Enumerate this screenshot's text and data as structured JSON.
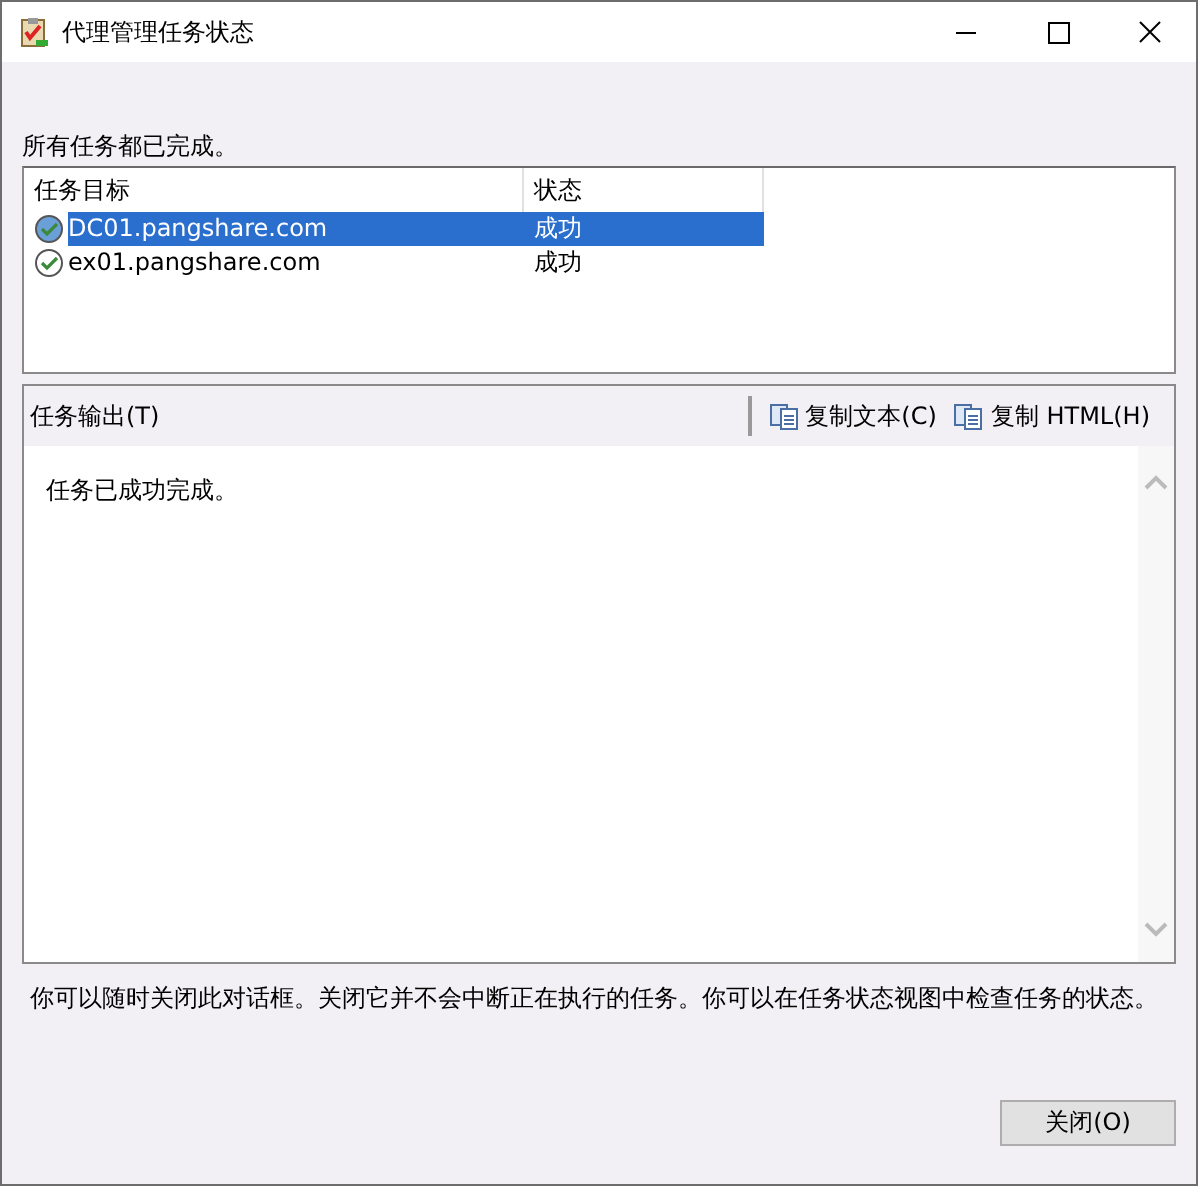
{
  "window": {
    "title": "代理管理任务状态"
  },
  "summary": "所有任务都已完成。",
  "table": {
    "columns": [
      "任务目标",
      "状态"
    ],
    "rows": [
      {
        "target": "DC01.pangshare.com",
        "status": "成功",
        "selected": true
      },
      {
        "target": "ex01.pangshare.com",
        "status": "成功",
        "selected": false
      }
    ]
  },
  "output": {
    "label": "任务输出(T)",
    "buttons": [
      "复制文本(C)",
      "复制 HTML(H)"
    ],
    "text": "任务已成功完成。"
  },
  "note": "你可以随时关闭此对话框。关闭它并不会中断正在执行的任务。你可以在任务状态视图中检查任务的状态。",
  "close_button": "关闭(O)"
}
